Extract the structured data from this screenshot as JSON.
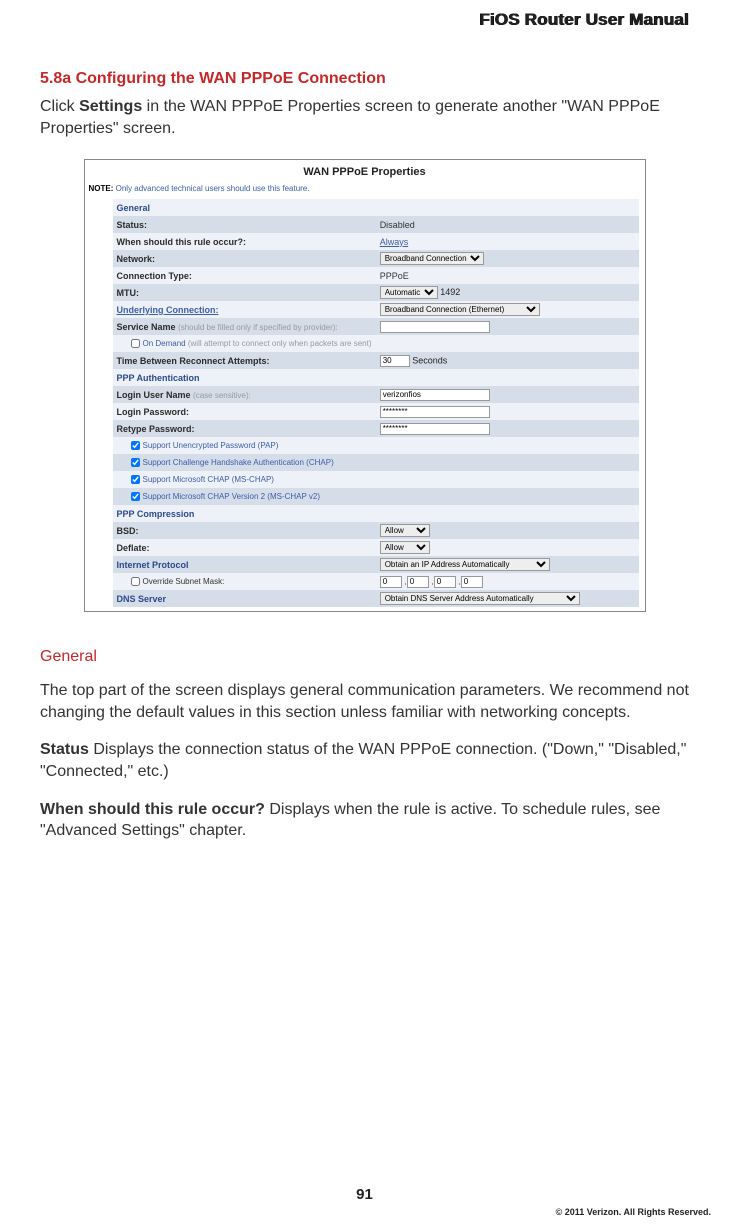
{
  "header": {
    "title": "FiOS Router User Manual"
  },
  "section": {
    "number": "5.8a  Configuring the WAN PPPoE Connection",
    "intro_pre": "Click ",
    "intro_bold": "Settings",
    "intro_post": " in the WAN PPPoE Properties screen to generate another \"WAN PPPoE Properties\" screen."
  },
  "screenshot": {
    "title": "WAN PPPoE Properties",
    "note_label": "NOTE:",
    "note_text": " Only advanced technical users should use this feature.",
    "rows": {
      "general": "General",
      "status_label": "Status:",
      "status_value": "Disabled",
      "when_label": "When should this rule occur?:",
      "when_value": "Always",
      "network_label": "Network:",
      "network_value": "Broadband Connection",
      "conn_type_label": "Connection Type:",
      "conn_type_value": "PPPoE",
      "mtu_label": "MTU:",
      "mtu_sel": "Automatic",
      "mtu_num": "1492",
      "underlying_label": "Underlying Connection:",
      "underlying_value": "Broadband Connection (Ethernet)",
      "service_label": "Service Name ",
      "service_hint": "(should be filled only if specified by provider):",
      "ondemand_label": "On Demand ",
      "ondemand_hint": "(will attempt to connect only when packets are sent)",
      "reconnect_label": "Time Between Reconnect Attempts:",
      "reconnect_value": "30",
      "reconnect_unit": "Seconds",
      "ppp_auth": "PPP Authentication",
      "login_user_label": "Login User Name ",
      "login_user_hint": "(case sensitive):",
      "login_user_value": "verizonfios",
      "login_pass_label": "Login Password:",
      "login_pass_value": "********",
      "retype_label": "Retype Password:",
      "retype_value": "********",
      "pap": "Support Unencrypted Password (PAP)",
      "chap": "Support Challenge Handshake Authentication (CHAP)",
      "mschap": "Support Microsoft CHAP (MS-CHAP)",
      "mschap2": "Support Microsoft CHAP Version 2 (MS-CHAP v2)",
      "ppp_comp": "PPP Compression",
      "bsd_label": "BSD:",
      "bsd_value": "Allow",
      "deflate_label": "Deflate:",
      "deflate_value": "Allow",
      "ip_label": "Internet Protocol",
      "ip_value": "Obtain an IP Address Automatically",
      "subnet_label": "Override Subnet Mask:",
      "subnet_oct": "0",
      "dns_label": "DNS Server",
      "dns_value": "Obtain DNS Server Address Automatically"
    }
  },
  "general": {
    "heading": "General",
    "para1": "The top part of the screen displays general communication parameters. We recommend not changing the default values in this section unless familiar with networking concepts.",
    "status_bold": "Status",
    "status_text": "  Displays the connection status of the WAN PPPoE connection. (\"Down,\" \"Disabled,\" \"Connected,\" etc.)",
    "when_bold": "When should this rule occur?",
    "when_text": "  Displays when the rule is active. To schedule rules, see \"Advanced Settings\" chapter."
  },
  "footer": {
    "page": "91",
    "copyright": "© 2011 Verizon. All Rights Reserved."
  }
}
